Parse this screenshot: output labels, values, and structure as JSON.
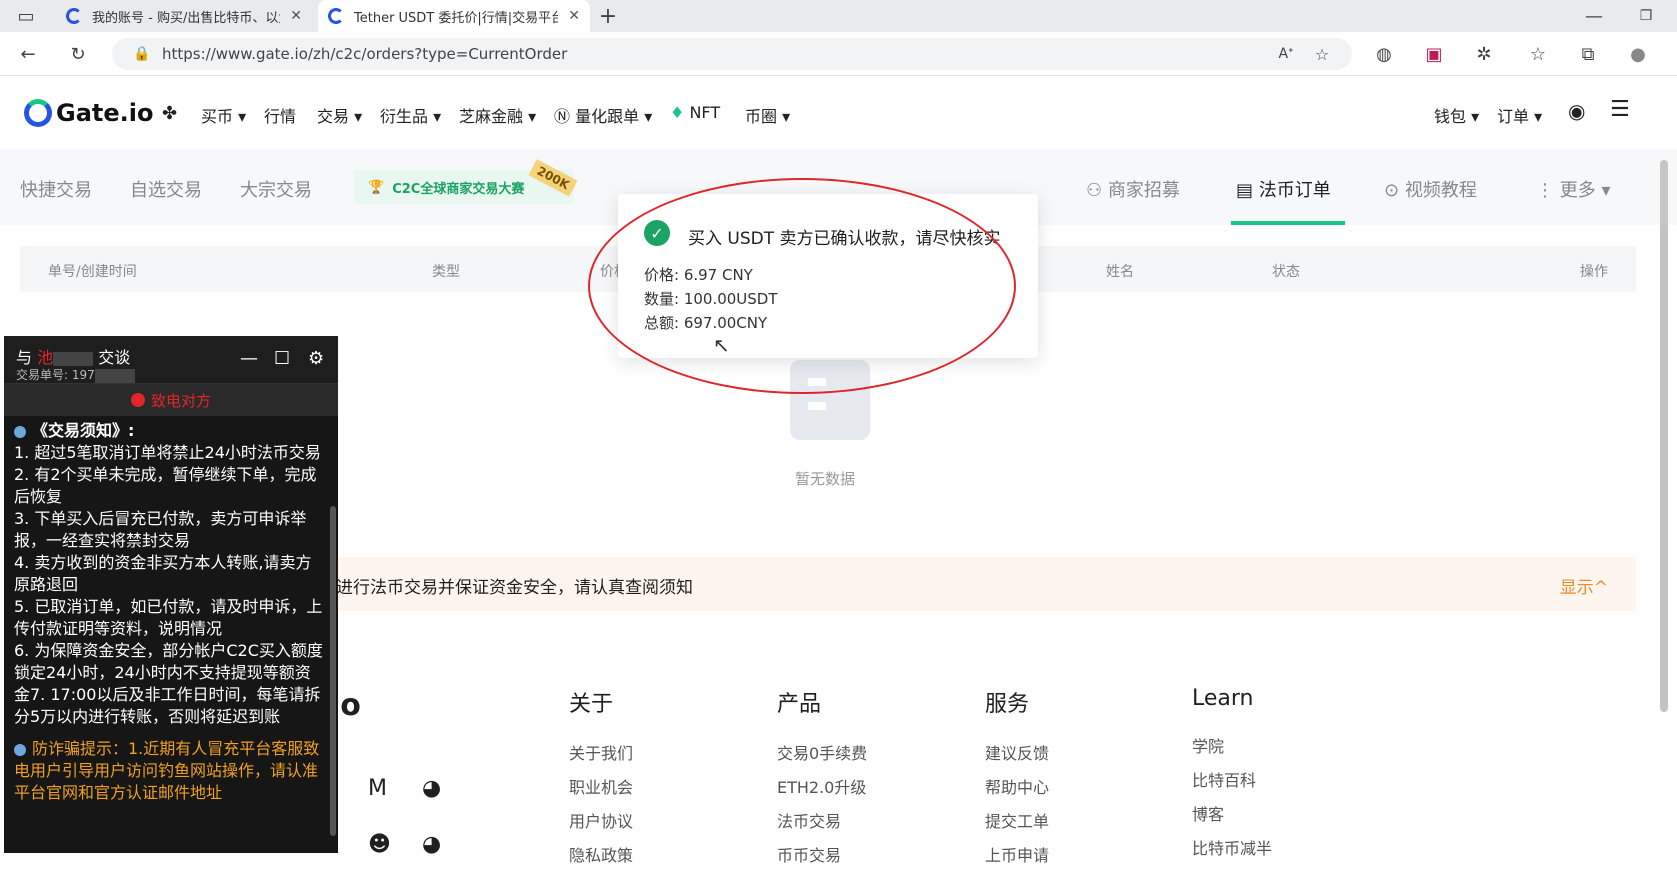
{
  "browser": {
    "tabs": [
      {
        "title": "我的账号 - 购买/出售比特币、以太"
      },
      {
        "title": "Tether USDT 委托价|行情|交易平台"
      }
    ],
    "url": "https://www.gate.io/zh/c2c/orders?type=CurrentOrder"
  },
  "site": {
    "logo": "Gate.io",
    "nav": [
      "买币 ▾",
      "行情",
      "交易 ▾",
      "衍生品 ▾",
      "芝麻金融 ▾",
      "量化跟单 ▾",
      "NFT",
      "币圈 ▾"
    ],
    "right_nav": [
      "钱包 ▾",
      "订单 ▾"
    ]
  },
  "subnav": {
    "left": [
      "快捷交易",
      "自选交易",
      "大宗交易"
    ],
    "banner": "C2C全球商家交易大赛",
    "banner_badge": "200K",
    "right": [
      "商家招募",
      "法币订单",
      "视频教程",
      "更多 ▾"
    ]
  },
  "table": {
    "headers": [
      "单号/创建时间",
      "类型",
      "价格",
      "姓名",
      "状态",
      "操作"
    ],
    "empty": "暂无数据"
  },
  "notice": {
    "text": "进行法币交易并保证资金安全，请认真查阅须知",
    "show": "显示^"
  },
  "footer": {
    "logo_partial": "io",
    "columns": [
      {
        "title": "关于",
        "items": [
          "关于我们",
          "职业机会",
          "用户协议",
          "隐私政策"
        ]
      },
      {
        "title": "产品",
        "items": [
          "交易0手续费",
          "ETH2.0升级",
          "法币交易",
          "币币交易"
        ]
      },
      {
        "title": "服务",
        "items": [
          "建议反馈",
          "帮助中心",
          "提交工单",
          "上币申请"
        ]
      },
      {
        "title": "Learn",
        "items": [
          "学院",
          "比特百科",
          "博客",
          "比特币减半"
        ]
      }
    ]
  },
  "toast": {
    "message": "买入 USDT 卖方已确认收款，请尽快核实",
    "price": "价格: 6.97 CNY",
    "quantity": "数量: 100.00USDT",
    "total": "总额: 697.00CNY"
  },
  "chat": {
    "title_prefix": "与",
    "title_name": "池",
    "title_suffix": "交谈",
    "order_label": "交易单号: 197",
    "call": "致电对方",
    "notice_title": "《交易须知》:",
    "rules": [
      "1. 超过5笔取消订单将禁止24小时法币交易",
      "2. 有2个买单未完成，暂停继续下单，完成后恢复",
      "3. 下单买入后冒充已付款，卖方可申诉举报，一经查实将禁封交易",
      "4. 卖方收到的资金非买方本人转账,请卖方原路退回",
      "5. 已取消订单，如已付款，请及时申诉，上传付款证明等资料，说明情况",
      "6. 为保障资金安全，部分帐户C2C买入额度锁定24小时，24小时内不支持提现等额资金7. 17:00以后及非工作日时间，每笔请拆分5万以内进行转账，否则将延迟到账"
    ],
    "warning": "防诈骗提示：1.近期有人冒充平台客服致电用户引导用户访问钓鱼网站操作，请认准平台官网和官方认证邮件地址"
  }
}
